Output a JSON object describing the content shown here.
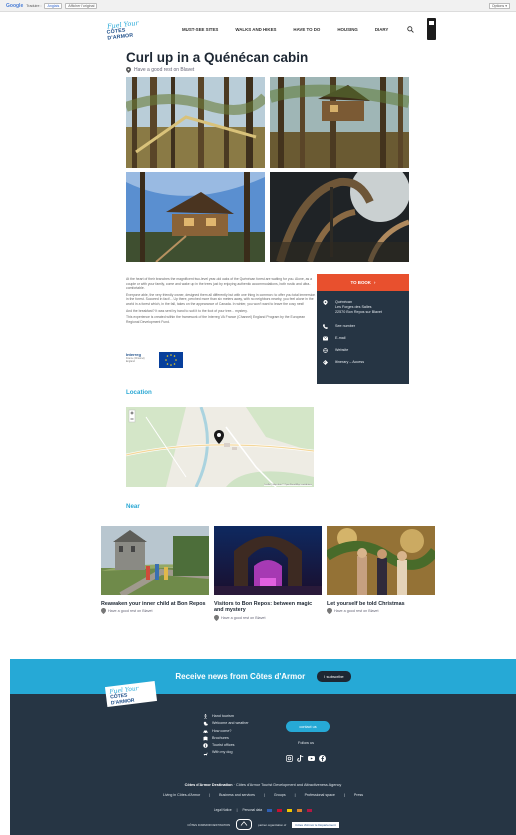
{
  "translate_bar": {
    "logo": "Google",
    "label": "Traduire :",
    "lang": "Anglais",
    "original": "Afficher l'original",
    "options": "Options ▾"
  },
  "brand": {
    "line1": "Fuel Your",
    "line2": "CÔTES D'ARMOR"
  },
  "nav": {
    "items": [
      "MUST-SEE SITES",
      "WALKS AND HIKES",
      "HAVE TO DO",
      "HOUSING",
      "DIARY"
    ]
  },
  "page": {
    "title": "Curl up in a Quénécan cabin",
    "subtitle": "Have a good rest on Blavet"
  },
  "description": {
    "paragraphs": [
      "At the heart of their branches the magnificent two-level year-old oaks of the Quénécan forest are waiting for you. Alone, as a couple or with your family, come and wake up in the trees just by enjoying authentic accommodations, both rustic and ultra-comfortable.",
      "Everyone able, the very friendly owner, designed them all differently but with one thing in common: to offer you total immersion in the forest. Succeed in fact!... Up there, perched more than six meters away, with no neighbors nearby, you feel alone in the world in a forest which, in the fall, takes on the appearance of Canada. In winter, you won't want to leave the cosy nest!",
      "And the breakfast? It was sent by hand to suit it to the foot of your tree... mystery.",
      "This experience is created within the framework of the Interreg VA France (Channel) England Program by the European Regional Development Fund."
    ],
    "logo_interreg": "Interreg",
    "logo_interreg_sub": "France (Channel) England"
  },
  "booking": {
    "button": "TO BOOK",
    "address": [
      "Quénécan",
      "Les Forges des Salles",
      "22570 Bon Repos sur Blavet"
    ],
    "phone": "See number",
    "email": "E-mail",
    "website": "Website",
    "itinerary": "Itinerary – Access"
  },
  "sections": {
    "location": "Location",
    "near": "Near"
  },
  "map": {
    "attribution": "Leaflet | Map data © OpenStreetMap contributors"
  },
  "near": [
    {
      "title": "Reawaken your inner child at Bon Repos",
      "place": "Have a good rest on Blavet"
    },
    {
      "title": "Visitors to Bon Repos: between magic and mystery",
      "place": "Have a good rest on Blavet"
    },
    {
      "title": "Let yourself be told Christmas",
      "place": "Have a good rest on Blavet"
    }
  ],
  "newsletter": {
    "text": "Receive news from Côtes d'Armor",
    "button": "I subscribe"
  },
  "footer": {
    "links": [
      "Hand tourism",
      "Welcome and weather",
      "How come?",
      "Brochures",
      "Tourist offices",
      "With my dog"
    ],
    "contact": "contact us",
    "follow": "Follow us",
    "org_bold": "Côtes d'Armor Destination",
    "org_rest": " · Côtes d'Armor Tourist Development and Attractiveness Agency",
    "row": [
      "Living in Côtes-d'Armor",
      "Business and services",
      "Groups",
      "Professional space",
      "Press"
    ],
    "row2": [
      "Legal Notice",
      "Personal data"
    ],
    "row3_left": "CÔTES D'ARMOR DESTINATION",
    "row3_mid": "partner organization of",
    "badge": "Côtes d'Armor le Département"
  },
  "colors": {
    "accent": "#26a9d6",
    "book": "#e8502e",
    "dark": "#263544"
  }
}
